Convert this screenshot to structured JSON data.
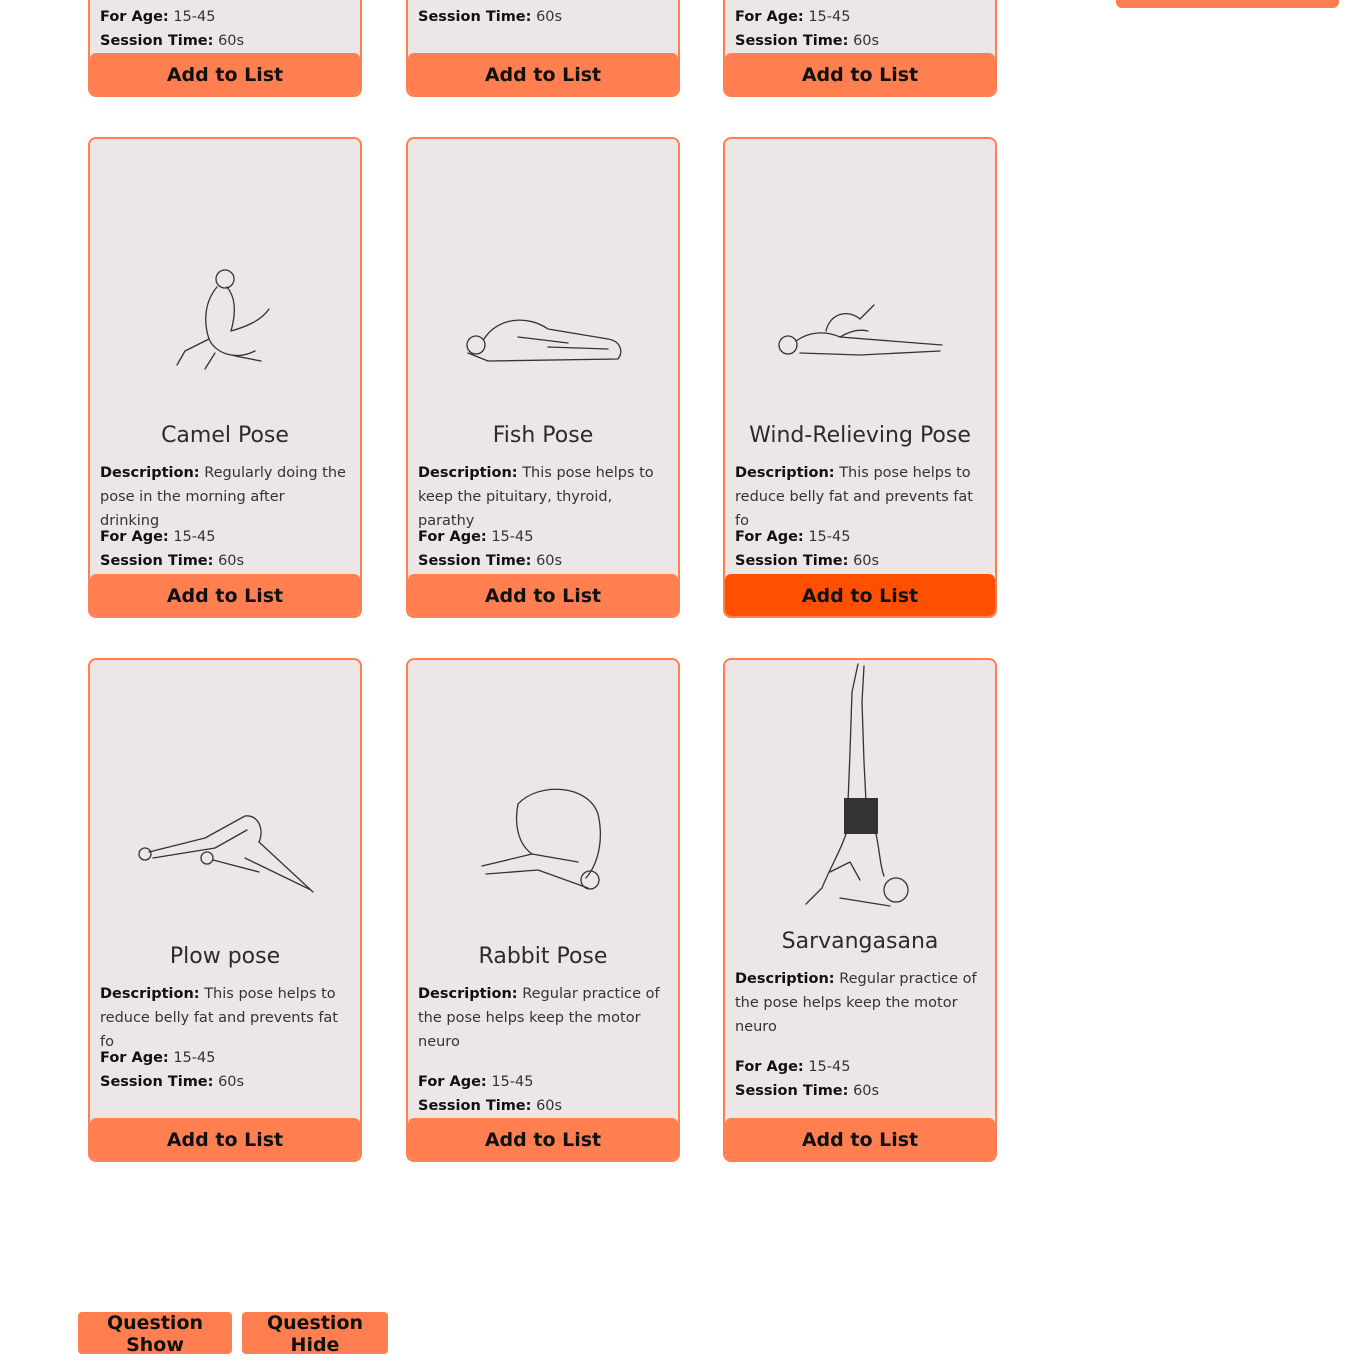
{
  "colors": {
    "accent": "#ff7f50",
    "accent_active": "#ff4f00",
    "card_bg": "#ede6e6"
  },
  "labels": {
    "description": "Description:",
    "for_age": "For Age:",
    "session_time": "Session Time:",
    "add_button": "Add to List"
  },
  "top_row": [
    {
      "for_age": "15-45",
      "session_time": "60s"
    },
    {
      "session_time": "60s"
    },
    {
      "for_age": "15-45",
      "session_time": "60s"
    }
  ],
  "cards": [
    {
      "title": "Camel Pose",
      "description": "Regularly doing the pose in the morning after drinking",
      "for_age": "15-45",
      "session_time": "60s",
      "image": "camel-pose-illustration"
    },
    {
      "title": "Fish Pose",
      "description": "This pose helps to keep the pituitary, thyroid, parathy",
      "for_age": "15-45",
      "session_time": "60s",
      "image": "fish-pose-illustration"
    },
    {
      "title": "Wind-Relieving Pose",
      "description": "This pose helps to reduce belly fat and prevents fat fo",
      "for_age": "15-45",
      "session_time": "60s",
      "image": "wind-relieving-pose-illustration"
    },
    {
      "title": "Plow pose",
      "description": "This pose helps to reduce belly fat and prevents fat fo",
      "for_age": "15-45",
      "session_time": "60s",
      "image": "plow-pose-illustration"
    },
    {
      "title": "Rabbit Pose",
      "description": "Regular practice of the pose helps keep the motor neuro",
      "for_age": "15-45",
      "session_time": "60s",
      "image": "rabbit-pose-illustration"
    },
    {
      "title": "Sarvangasana",
      "description": "Regular practice of the pose helps keep the motor neuro",
      "for_age": "15-45",
      "session_time": "60s",
      "image": "sarvangasana-illustration"
    }
  ],
  "footer": {
    "question_show": "Question Show",
    "question_hide": "Question Hide"
  }
}
